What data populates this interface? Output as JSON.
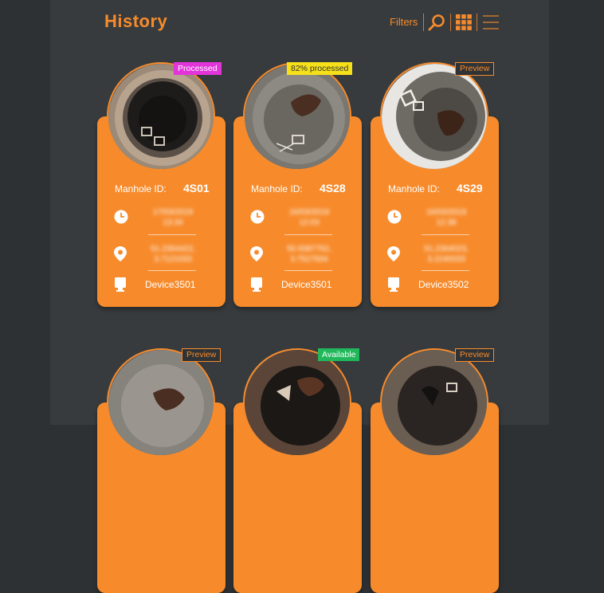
{
  "header": {
    "title": "History",
    "filters_label": "Filters"
  },
  "labels": {
    "manhole_id": "Manhole ID:"
  },
  "colors": {
    "accent": "#f78b2c",
    "background": "#2e3133",
    "processed": "#e234d9",
    "partial": "#f5e01a",
    "available": "#20b85a"
  },
  "cards": [
    {
      "badge": "Processed",
      "manhole_id": "4S01",
      "timestamp": "17/03/2019\n13:34",
      "location": "51.2364422,\n3.7121033",
      "device": "Device3501"
    },
    {
      "badge": "82% processed",
      "manhole_id": "4S28",
      "timestamp": "16/03/2019\n12:03",
      "location": "50.9387762,\n3.7527934",
      "device": "Device3501"
    },
    {
      "badge": "Preview",
      "manhole_id": "4S29",
      "timestamp": "16/03/2019\n12:38",
      "location": "51.2364023,\n3.2240033",
      "device": "Device3502"
    },
    {
      "badge": "Preview"
    },
    {
      "badge": "Available"
    },
    {
      "badge": "Preview"
    }
  ]
}
